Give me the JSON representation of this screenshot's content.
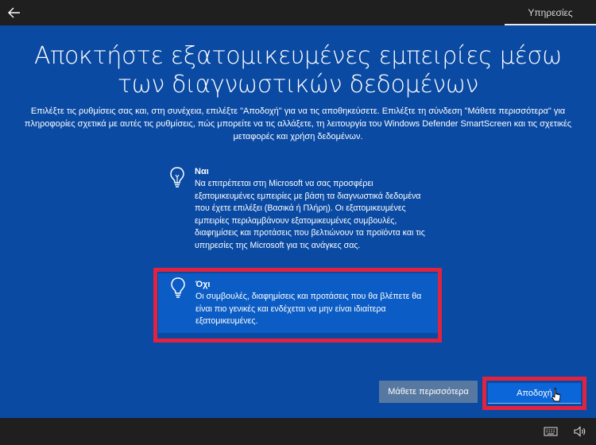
{
  "topbar": {
    "back_icon": "back-arrow-icon",
    "section_label": "Υπηρεσίες"
  },
  "main": {
    "title_line1": "Αποκτήστε εξατομικευμένες εμπειρίες μέσω",
    "title_line2": "των διαγνωστικών δεδομένων",
    "description": "Επιλέξτε τις ρυθμίσεις σας και, στη συνέχεια, επιλέξτε \"Αποδοχή\" για να τις αποθηκεύσετε. Επιλέξτε τη σύνδεση \"Μάθετε περισσότερα\" για πληροφορίες σχετικά με αυτές τις ρυθμίσεις, πώς μπορείτε να τις αλλάξετε, τη λειτουργία του Windows Defender SmartScreen και τις σχετικές μεταφορές και χρήση δεδομένων."
  },
  "options": [
    {
      "icon": "lightbulb-icon",
      "title": "Ναι",
      "body": "Να επιτρέπεται στη Microsoft να σας προσφέρει εξατομικευμένες εμπειρίες με βάση τα διαγνωστικά δεδομένα που έχετε επιλέξει (Βασικά ή Πλήρη). Οι εξατομικευμένες εμπειρίες περιλαμβάνουν εξατομικευμένες συμβουλές, διαφημίσεις και προτάσεις που βελτιώνουν τα προϊόντα και τις υπηρεσίες της Microsoft για τις ανάγκες σας.",
      "selected": false
    },
    {
      "icon": "lightbulb-outline-icon",
      "title": "Όχι",
      "body": "Οι συμβουλές, διαφημίσεις και προτάσεις που θα βλέπετε θα είναι πιο γενικές και ενδέχεται να μην είναι ιδιαίτερα εξατομικευμένες.",
      "selected": true
    }
  ],
  "buttons": {
    "learn_more": "Μάθετε περισσότερα",
    "accept": "Αποδοχή"
  },
  "colors": {
    "background": "#0a4aa3",
    "selected_option": "#0b5cc4",
    "highlight": "#e1233f",
    "accept_button": "#0a66d9",
    "learn_more_button": "#5778a0",
    "bars": "#1f1f1f"
  },
  "taskbar": {
    "keyboard_icon": "keyboard-icon",
    "volume_icon": "volume-icon"
  }
}
